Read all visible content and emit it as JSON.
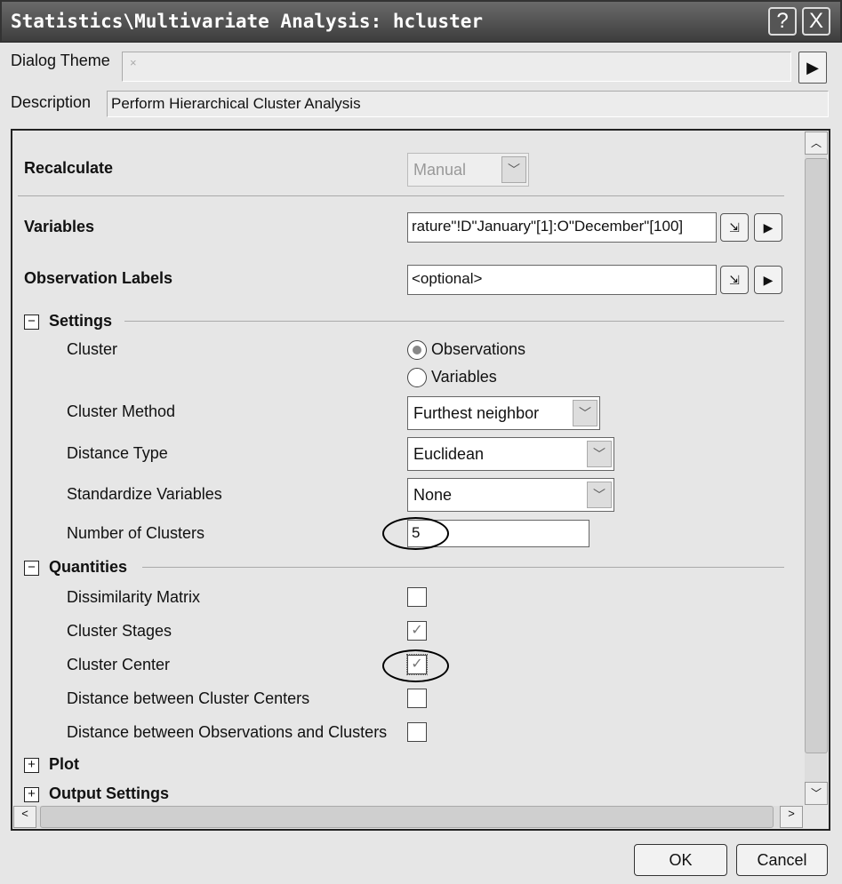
{
  "window": {
    "title": "Statistics\\Multivariate Analysis: hcluster",
    "help_icon": "?",
    "close_icon": "X"
  },
  "dialog_theme": {
    "label": "Dialog Theme",
    "value": "×"
  },
  "description": {
    "label": "Description",
    "value": "Perform Hierarchical Cluster Analysis"
  },
  "recalculate": {
    "label": "Recalculate",
    "value": "Manual"
  },
  "variables": {
    "label": "Variables",
    "value": "rature\"!D\"January\"[1]:O\"December\"[100]"
  },
  "observation_labels": {
    "label": "Observation Labels",
    "value": "<optional>"
  },
  "settings": {
    "label": "Settings",
    "toggle": "−",
    "cluster": {
      "label": "Cluster",
      "options": [
        "Observations",
        "Variables"
      ],
      "selected": "Observations"
    },
    "cluster_method": {
      "label": "Cluster Method",
      "value": "Furthest neighbor"
    },
    "distance_type": {
      "label": "Distance Type",
      "value": "Euclidean"
    },
    "standardize": {
      "label": "Standardize Variables",
      "value": "None"
    },
    "num_clusters": {
      "label": "Number of Clusters",
      "value": "5"
    }
  },
  "quantities": {
    "label": "Quantities",
    "toggle": "−",
    "items": [
      {
        "label": "Dissimilarity Matrix",
        "checked": false
      },
      {
        "label": "Cluster Stages",
        "checked": true
      },
      {
        "label": "Cluster Center",
        "checked": true
      },
      {
        "label": "Distance between Cluster Centers",
        "checked": false
      },
      {
        "label": "Distance between Observations and Clusters",
        "checked": false
      }
    ]
  },
  "plot": {
    "label": "Plot",
    "toggle": "+"
  },
  "output_settings": {
    "label": "Output Settings",
    "toggle": "+"
  },
  "buttons": {
    "ok": "OK",
    "cancel": "Cancel"
  },
  "check_mark": "✓"
}
